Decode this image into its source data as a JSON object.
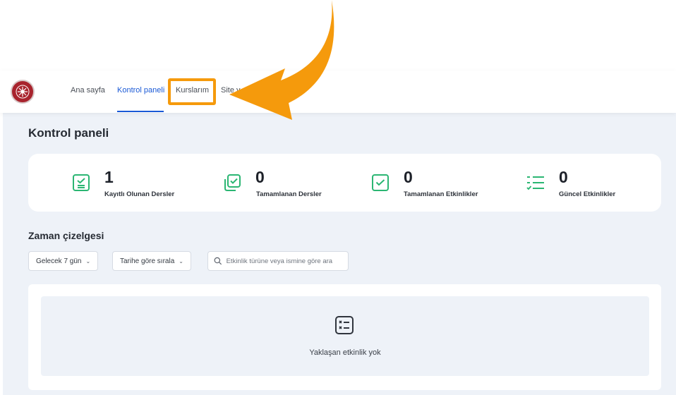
{
  "nav": {
    "items": [
      {
        "label": "Ana sayfa",
        "active": false
      },
      {
        "label": "Kontrol paneli",
        "active": true
      },
      {
        "label": "Kurslarım",
        "active": false
      },
      {
        "label": "Site y",
        "active": false
      }
    ]
  },
  "page": {
    "title": "Kontrol paneli"
  },
  "stats": [
    {
      "value": "1",
      "label": "Kayıtlı Olunan Dersler",
      "icon": "enrolled-courses-icon"
    },
    {
      "value": "0",
      "label": "Tamamlanan Dersler",
      "icon": "completed-courses-icon"
    },
    {
      "value": "0",
      "label": "Tamamlanan Etkinlikler",
      "icon": "completed-activities-icon"
    },
    {
      "value": "0",
      "label": "Güncel Etkinlikler",
      "icon": "current-activities-icon"
    }
  ],
  "timeline": {
    "title": "Zaman çizelgesi",
    "range_label": "Gelecek 7 gün",
    "sort_label": "Tarihe göre sırala",
    "search_placeholder": "Etkinlik türüne veya ismine göre ara",
    "empty_text": "Yaklaşan etkinlik yok"
  },
  "colors": {
    "accent": "#1a59d6",
    "highlight": "#f59a0c",
    "icon_green": "#2bb673",
    "background": "#eef2f8"
  }
}
